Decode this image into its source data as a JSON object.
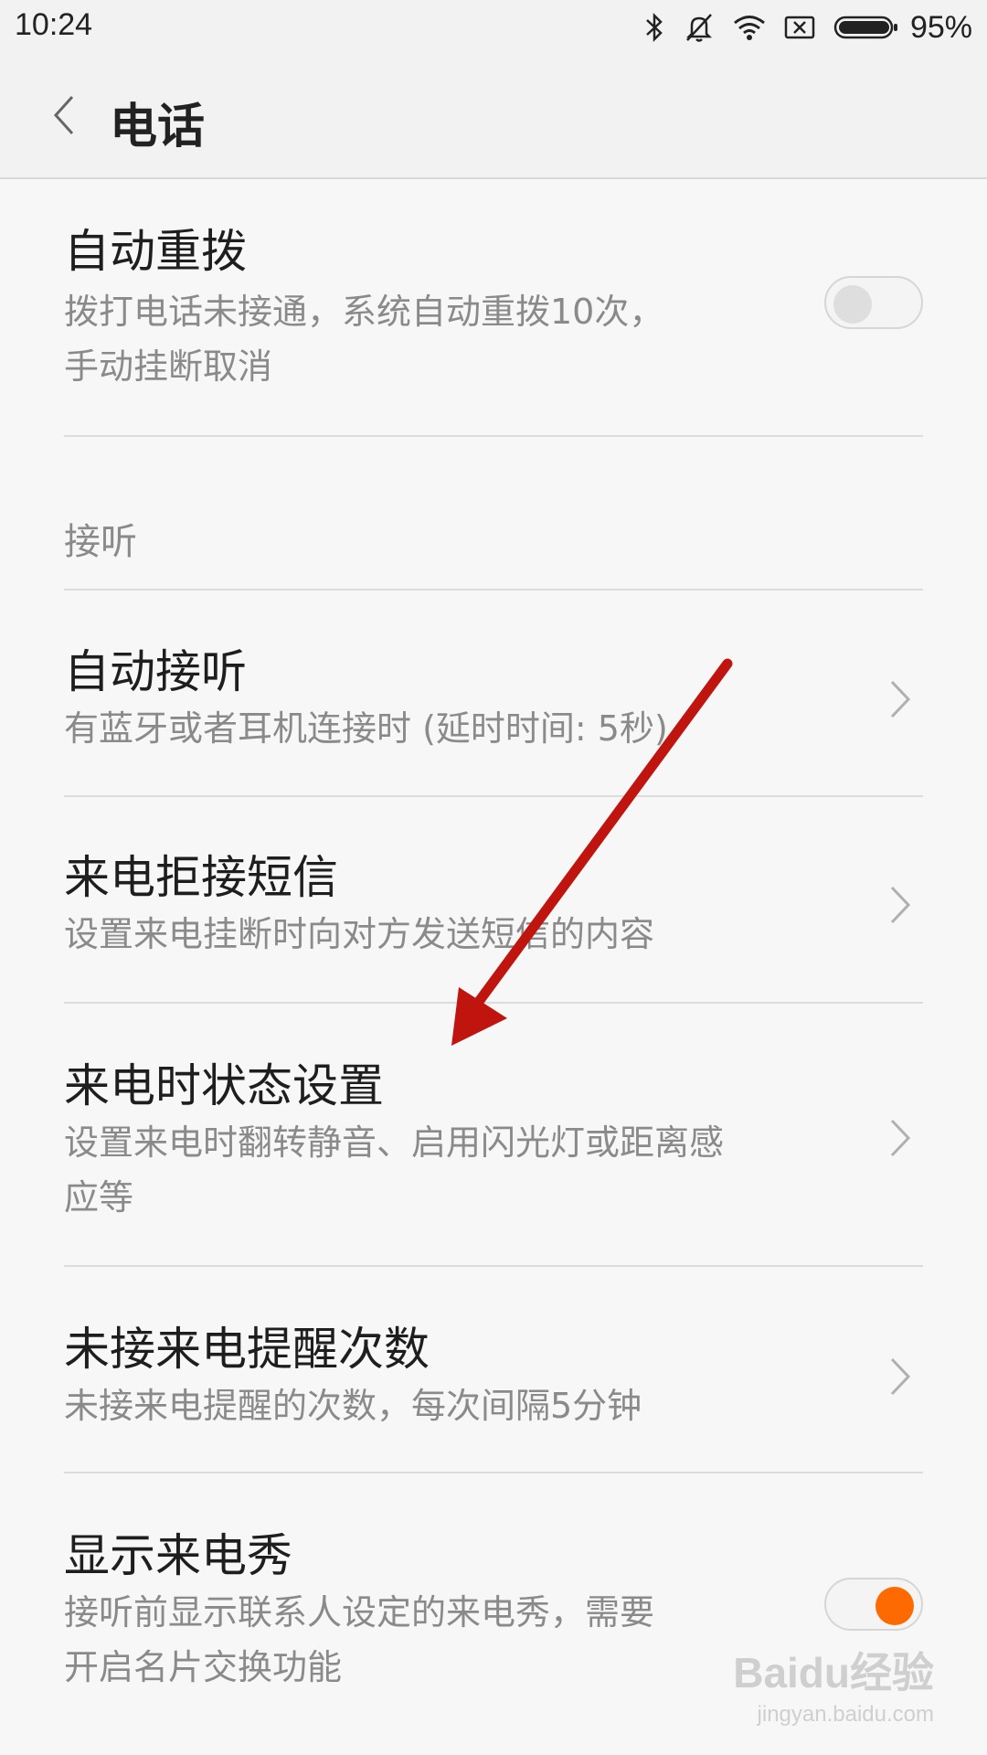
{
  "status_bar": {
    "time": "10:24",
    "battery": "95%",
    "icons": [
      "bluetooth-icon",
      "mute-bell-icon",
      "wifi-icon",
      "no-sim-icon",
      "battery-icon"
    ]
  },
  "header": {
    "back_icon": "chevron-left-icon",
    "title": "电话"
  },
  "settings": {
    "auto_redial": {
      "title": "自动重拨",
      "subtitle_line1": "拨打电话未接通，系统自动重拨10次，",
      "subtitle_line2": "手动挂断取消",
      "enabled": false
    },
    "section_answer": "接听",
    "auto_answer": {
      "title": "自动接听",
      "subtitle": "有蓝牙或者耳机连接时 (延时时间: 5秒)"
    },
    "reject_sms": {
      "title": "来电拒接短信",
      "subtitle": "设置来电挂断时向对方发送短信的内容"
    },
    "incoming_state": {
      "title": "来电时状态设置",
      "subtitle_line1": "设置来电时翻转静音、启用闪光灯或距离感",
      "subtitle_line2": "应等"
    },
    "missed_reminder": {
      "title": "未接来电提醒次数",
      "subtitle": "未接来电提醒的次数，每次间隔5分钟"
    },
    "caller_show": {
      "title": "显示来电秀",
      "subtitle_line1": "接听前显示联系人设定的来电秀，需要",
      "subtitle_line2": "开启名片交换功能",
      "enabled": true
    }
  },
  "annotation": {
    "arrow_color": "#c0140e"
  },
  "watermark": {
    "logo": "Baidu经验",
    "url": "jingyan.baidu.com"
  },
  "colors": {
    "accent": "#ff6a00",
    "background": "#f7f7f7",
    "subtitle": "#8a8a8a"
  }
}
